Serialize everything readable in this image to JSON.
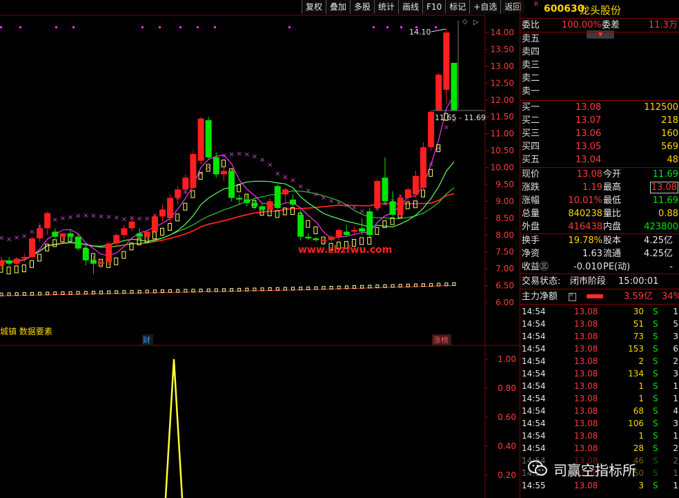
{
  "toolbar": {
    "items": [
      "复权",
      "叠加",
      "多股",
      "统计",
      "画线",
      "F10",
      "标记",
      "+自选",
      "返回"
    ]
  },
  "chart": {
    "price_axis": [
      "14.00",
      "13.50",
      "13.00",
      "12.50",
      "12.00",
      "11.50",
      "11.00",
      "10.50",
      "10.00",
      "9.50",
      "9.00",
      "8.50",
      "8.00",
      "7.50",
      "7.00",
      "6.50",
      "6.00"
    ],
    "indicator_axis": [
      "1.00",
      "0.80",
      "0.60",
      "0.40",
      "0.20"
    ],
    "high_label": "14.10",
    "range_label": "11.65 - 11.69",
    "watermark": "www.zbzfwu.com",
    "left_text": "城镇 数据要素",
    "cai_tag": "财",
    "zhangbang_tag": "涨榜",
    "candles": [
      {
        "o": 7.1,
        "h": 7.35,
        "l": 6.95,
        "c": 7.25
      },
      {
        "o": 7.25,
        "h": 7.35,
        "l": 7.1,
        "c": 7.15
      },
      {
        "o": 7.15,
        "h": 7.35,
        "l": 7.05,
        "c": 7.3
      },
      {
        "o": 7.3,
        "h": 7.45,
        "l": 7.2,
        "c": 7.35
      },
      {
        "o": 7.35,
        "h": 7.95,
        "l": 7.3,
        "c": 7.9
      },
      {
        "o": 7.9,
        "h": 8.35,
        "l": 7.8,
        "c": 8.2
      },
      {
        "o": 8.2,
        "h": 8.7,
        "l": 8.0,
        "c": 8.65
      },
      {
        "o": 8.1,
        "h": 8.2,
        "l": 7.9,
        "c": 7.95
      },
      {
        "o": 7.95,
        "h": 8.05,
        "l": 7.8,
        "c": 8.05
      },
      {
        "o": 8.05,
        "h": 8.15,
        "l": 7.8,
        "c": 7.95
      },
      {
        "o": 7.95,
        "h": 8.05,
        "l": 7.55,
        "c": 7.6
      },
      {
        "o": 7.6,
        "h": 7.75,
        "l": 7.1,
        "c": 7.25
      },
      {
        "o": 7.25,
        "h": 7.4,
        "l": 6.85,
        "c": 7.15
      },
      {
        "o": 7.15,
        "h": 7.3,
        "l": 7.0,
        "c": 7.2
      },
      {
        "o": 7.2,
        "h": 7.8,
        "l": 7.1,
        "c": 7.75
      },
      {
        "o": 7.75,
        "h": 8.05,
        "l": 7.65,
        "c": 8.0
      },
      {
        "o": 8.0,
        "h": 8.3,
        "l": 7.9,
        "c": 8.2
      },
      {
        "o": 8.2,
        "h": 8.5,
        "l": 8.1,
        "c": 8.4
      },
      {
        "o": 8.05,
        "h": 8.2,
        "l": 7.85,
        "c": 7.95
      },
      {
        "o": 7.95,
        "h": 8.1,
        "l": 7.85,
        "c": 8.1
      },
      {
        "o": 8.1,
        "h": 8.6,
        "l": 8.0,
        "c": 8.55
      },
      {
        "o": 8.55,
        "h": 8.9,
        "l": 8.4,
        "c": 8.75
      },
      {
        "o": 8.5,
        "h": 9.2,
        "l": 8.35,
        "c": 9.1
      },
      {
        "o": 9.1,
        "h": 9.45,
        "l": 8.9,
        "c": 9.35
      },
      {
        "o": 9.35,
        "h": 9.8,
        "l": 9.2,
        "c": 9.7
      },
      {
        "o": 9.4,
        "h": 10.5,
        "l": 9.3,
        "c": 10.4
      },
      {
        "o": 10.2,
        "h": 11.5,
        "l": 10.1,
        "c": 11.45
      },
      {
        "o": 11.4,
        "h": 11.5,
        "l": 10.25,
        "c": 10.3
      },
      {
        "o": 10.3,
        "h": 10.45,
        "l": 9.7,
        "c": 9.8
      },
      {
        "o": 9.8,
        "h": 10.05,
        "l": 9.6,
        "c": 9.9
      },
      {
        "o": 9.9,
        "h": 9.95,
        "l": 9.0,
        "c": 9.1
      },
      {
        "o": 9.1,
        "h": 9.2,
        "l": 8.9,
        "c": 9.05
      },
      {
        "o": 9.05,
        "h": 9.2,
        "l": 8.85,
        "c": 8.95
      },
      {
        "o": 8.95,
        "h": 9.1,
        "l": 8.75,
        "c": 8.85
      },
      {
        "o": 8.85,
        "h": 8.95,
        "l": 8.7,
        "c": 8.75
      },
      {
        "o": 8.75,
        "h": 9.1,
        "l": 8.65,
        "c": 9.0
      },
      {
        "o": 9.45,
        "h": 9.5,
        "l": 8.75,
        "c": 8.8
      },
      {
        "o": 9.2,
        "h": 9.4,
        "l": 8.95,
        "c": 9.35
      },
      {
        "o": 9.05,
        "h": 9.2,
        "l": 8.85,
        "c": 8.9
      },
      {
        "o": 8.6,
        "h": 8.75,
        "l": 7.85,
        "c": 7.95
      },
      {
        "o": 7.95,
        "h": 8.05,
        "l": 7.85,
        "c": 7.9
      },
      {
        "o": 7.9,
        "h": 7.95,
        "l": 7.8,
        "c": 7.85
      },
      {
        "o": 7.85,
        "h": 7.95,
        "l": 7.75,
        "c": 7.85
      },
      {
        "o": 7.85,
        "h": 8.0,
        "l": 7.8,
        "c": 7.95
      },
      {
        "o": 7.95,
        "h": 8.2,
        "l": 7.85,
        "c": 8.15
      },
      {
        "o": 8.1,
        "h": 8.3,
        "l": 7.95,
        "c": 8.0
      },
      {
        "o": 8.1,
        "h": 8.25,
        "l": 8.0,
        "c": 8.15
      },
      {
        "o": 8.2,
        "h": 8.5,
        "l": 8.0,
        "c": 8.1
      },
      {
        "o": 8.7,
        "h": 8.8,
        "l": 7.9,
        "c": 8.0
      },
      {
        "o": 8.8,
        "h": 9.65,
        "l": 8.7,
        "c": 9.6
      },
      {
        "o": 9.7,
        "h": 10.3,
        "l": 8.9,
        "c": 9.0
      },
      {
        "o": 9.0,
        "h": 9.3,
        "l": 8.55,
        "c": 8.6
      },
      {
        "o": 8.6,
        "h": 9.2,
        "l": 8.5,
        "c": 9.1
      },
      {
        "o": 9.1,
        "h": 9.4,
        "l": 9.0,
        "c": 9.35
      },
      {
        "o": 9.2,
        "h": 9.9,
        "l": 9.1,
        "c": 9.75
      },
      {
        "o": 9.4,
        "h": 10.75,
        "l": 9.3,
        "c": 10.6
      },
      {
        "o": 10.6,
        "h": 11.7,
        "l": 10.5,
        "c": 11.65
      },
      {
        "o": 11.7,
        "h": 12.8,
        "l": 12.3,
        "c": 12.75
      },
      {
        "o": 12.3,
        "h": 14.1,
        "l": 11.9,
        "c": 14.0
      },
      {
        "o": 13.1,
        "h": 13.1,
        "l": 11.7,
        "c": 11.7
      }
    ]
  },
  "panel": {
    "r_mark": "R",
    "code": "600630",
    "name": "龙头股份",
    "weibi": {
      "label": "委比",
      "value": "100.00%",
      "label2": "委差",
      "value2": "11.3万"
    },
    "sells": [
      "卖五",
      "卖四",
      "卖三",
      "卖二",
      "卖一"
    ],
    "buys": [
      {
        "label": "买一",
        "price": "13.08",
        "vol": "112500"
      },
      {
        "label": "买二",
        "price": "13.07",
        "vol": "218"
      },
      {
        "label": "买三",
        "price": "13.06",
        "vol": "160"
      },
      {
        "label": "买四",
        "price": "13.05",
        "vol": "569"
      },
      {
        "label": "买五",
        "price": "13.04",
        "vol": "48"
      }
    ],
    "quote": [
      {
        "l1": "现价",
        "v1": "13.08",
        "l2": "今开",
        "v2": "11.69"
      },
      {
        "l1": "涨跌",
        "v1": "1.19",
        "l2": "最高",
        "v2": "13.08"
      },
      {
        "l1": "涨幅",
        "v1": "10.01%",
        "l2": "最低",
        "v2": "11.69"
      },
      {
        "l1": "总量",
        "v1": "840238",
        "l2": "量比",
        "v2": "0.88"
      },
      {
        "l1": "外盘",
        "v1": "416438",
        "l2": "内盘",
        "v2": "423800"
      }
    ],
    "stats": [
      {
        "l1": "换手",
        "v1": "19.78%",
        "l2": "股本",
        "v2": "4.25亿"
      },
      {
        "l1": "净资",
        "v1": "1.63",
        "l2": "流通",
        "v2": "4.25亿"
      },
      {
        "l1": "收益㊂",
        "v1": "-0.010",
        "l2": "PE(动)",
        "v2": "-"
      }
    ],
    "trade_status": {
      "label": "交易状态:",
      "value": "闭市阶段",
      "time": "15:00:01"
    },
    "main_force": {
      "label": "主力净额",
      "value": "3.59亿",
      "pct": "34%"
    },
    "ticks": [
      {
        "t": "14:54",
        "p": "13.08",
        "v": "30",
        "d": "S",
        "n": "1"
      },
      {
        "t": "14:54",
        "p": "13.08",
        "v": "51",
        "d": "S",
        "n": "5"
      },
      {
        "t": "14:54",
        "p": "13.08",
        "v": "73",
        "d": "S",
        "n": "3"
      },
      {
        "t": "14:54",
        "p": "13.08",
        "v": "153",
        "d": "S",
        "n": "6"
      },
      {
        "t": "14:54",
        "p": "13.08",
        "v": "2",
        "d": "S",
        "n": "2"
      },
      {
        "t": "14:54",
        "p": "13.08",
        "v": "134",
        "d": "S",
        "n": "3"
      },
      {
        "t": "14:54",
        "p": "13.08",
        "v": "1",
        "d": "S",
        "n": "1"
      },
      {
        "t": "14:54",
        "p": "13.08",
        "v": "1",
        "d": "S",
        "n": "1"
      },
      {
        "t": "14:54",
        "p": "13.08",
        "v": "68",
        "d": "S",
        "n": "4"
      },
      {
        "t": "14:54",
        "p": "13.08",
        "v": "106",
        "d": "S",
        "n": "3"
      },
      {
        "t": "14:54",
        "p": "13.08",
        "v": "1",
        "d": "S",
        "n": "1"
      },
      {
        "t": "14:54",
        "p": "13.08",
        "v": "28",
        "d": "S",
        "n": "2"
      },
      {
        "t": "14:54",
        "p": "13.08",
        "v": "46",
        "d": "S",
        "n": "2"
      },
      {
        "t": "14:55",
        "p": "13.08",
        "v": "50",
        "d": "S",
        "n": "1"
      },
      {
        "t": "14:55",
        "p": "13.08",
        "v": "3",
        "d": "S",
        "n": "1"
      }
    ]
  },
  "watermark2": {
    "text": "司赢空指标所"
  }
}
